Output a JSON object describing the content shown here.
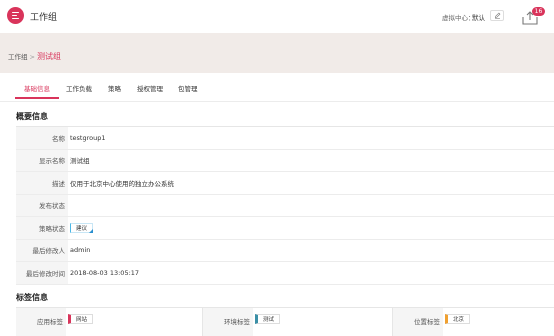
{
  "header": {
    "app_title": "工作组",
    "virtual_center_label": "虚拟中心：",
    "virtual_center_value": "默认",
    "task_badge_count": "16"
  },
  "breadcrumb": {
    "parent": "工作组",
    "separator": ">",
    "current": "测试组"
  },
  "tabs": [
    {
      "label": "基础信息",
      "active": true
    },
    {
      "label": "工作负载",
      "active": false
    },
    {
      "label": "策略",
      "active": false
    },
    {
      "label": "授权管理",
      "active": false
    },
    {
      "label": "包管理",
      "active": false
    }
  ],
  "overview": {
    "title": "概要信息",
    "rows": [
      {
        "label": "名称",
        "value": "testgroup1"
      },
      {
        "label": "显示名称",
        "value": "测试组"
      },
      {
        "label": "描述",
        "value": "仅用于北京中心使用的独立办公系统"
      },
      {
        "label": "发布状态",
        "value": ""
      },
      {
        "label": "策略状态",
        "value": "建议"
      },
      {
        "label": "最后修改人",
        "value": "admin"
      },
      {
        "label": "最后修改时间",
        "value": "2018-08-03 13:05:17"
      }
    ]
  },
  "labels": {
    "title": "标签信息",
    "cells": [
      {
        "label": "应用标签",
        "tag": "网站"
      },
      {
        "label": "环境标签",
        "tag": "测试"
      },
      {
        "label": "位置标签",
        "tag": "北京"
      }
    ]
  },
  "colors": {
    "accent": "#d9345b",
    "breadcrumb_band": "#f1ebe8",
    "status_tag_accent": "#4bb7e6",
    "env_tag_accent": "#3a8fa6",
    "location_tag_accent": "#f0a030"
  }
}
